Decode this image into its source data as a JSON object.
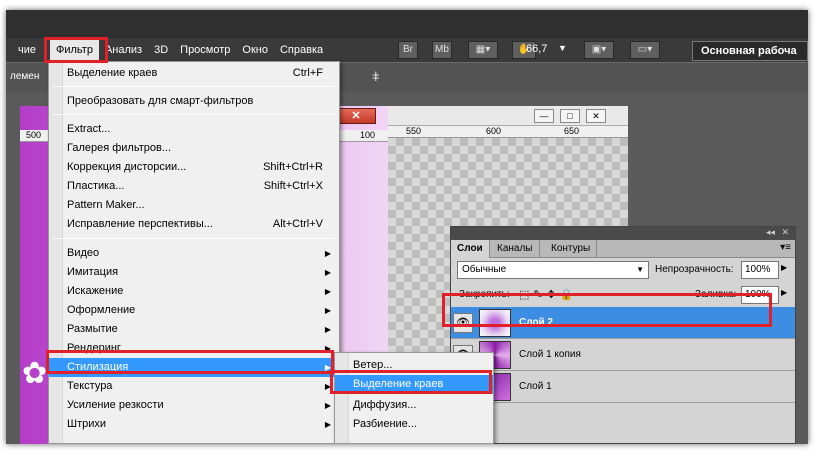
{
  "menubar": {
    "items": [
      {
        "label": "чие",
        "active": false
      },
      {
        "label": "Фильтр",
        "active": true
      },
      {
        "label": "Анализ",
        "active": false
      },
      {
        "label": "3D",
        "active": false
      },
      {
        "label": "Просмотр",
        "active": false
      },
      {
        "label": "Окно",
        "active": false
      },
      {
        "label": "Справка",
        "active": false
      }
    ],
    "br_label": "Br",
    "mb_label": "Mb",
    "zoom": "66,7",
    "workspace": "Основная рабоча"
  },
  "optbar": {
    "left_label": "лемен"
  },
  "rulers": {
    "doc1": [
      "500",
      "100"
    ],
    "doc2": [
      "550",
      "600",
      "650"
    ]
  },
  "filter_menu": {
    "items": [
      {
        "label": "Выделение краев",
        "shortcut": "Ctrl+F"
      },
      {
        "label": "Преобразовать для смарт-фильтров",
        "shortcut": ""
      },
      {
        "label": "Extract...",
        "shortcut": ""
      },
      {
        "label": "Галерея фильтров...",
        "shortcut": ""
      },
      {
        "label": "Коррекция дисторсии...",
        "shortcut": "Shift+Ctrl+R"
      },
      {
        "label": "Пластика...",
        "shortcut": "Shift+Ctrl+X"
      },
      {
        "label": "Pattern Maker...",
        "shortcut": ""
      },
      {
        "label": "Исправление перспективы...",
        "shortcut": "Alt+Ctrl+V"
      },
      {
        "label": "Видео",
        "shortcut": ""
      },
      {
        "label": "Имитация",
        "shortcut": ""
      },
      {
        "label": "Искажение",
        "shortcut": ""
      },
      {
        "label": "Оформление",
        "shortcut": ""
      },
      {
        "label": "Размытие",
        "shortcut": ""
      },
      {
        "label": "Рендеринг",
        "shortcut": ""
      },
      {
        "label": "Стилизация",
        "shortcut": ""
      },
      {
        "label": "Текстура",
        "shortcut": ""
      },
      {
        "label": "Усиление резкости",
        "shortcut": ""
      },
      {
        "label": "Штрихи",
        "shortcut": ""
      }
    ]
  },
  "submenu": {
    "items": [
      {
        "label": "Ветер..."
      },
      {
        "label": "Выделение краев"
      },
      {
        "label": "Диффузия..."
      },
      {
        "label": "Разбиение..."
      }
    ]
  },
  "layers_panel": {
    "tabs": [
      "Слои",
      "Каналы",
      "Контуры"
    ],
    "blend_mode": "Обычные",
    "opacity_label": "Непрозрачность:",
    "opacity_value": "100%",
    "lock_label": "Закрепить:",
    "fill_label": "Заливка:",
    "fill_value": "100%",
    "layers": [
      {
        "name": "Слой 2",
        "selected": true
      },
      {
        "name": "Слой 1 копия",
        "selected": false
      },
      {
        "name": "Слой 1",
        "selected": false
      }
    ]
  },
  "colors": {
    "highlight": "#3399ff",
    "annotation_red": "#e0202a",
    "layer_selected": "#3d8ee3"
  }
}
